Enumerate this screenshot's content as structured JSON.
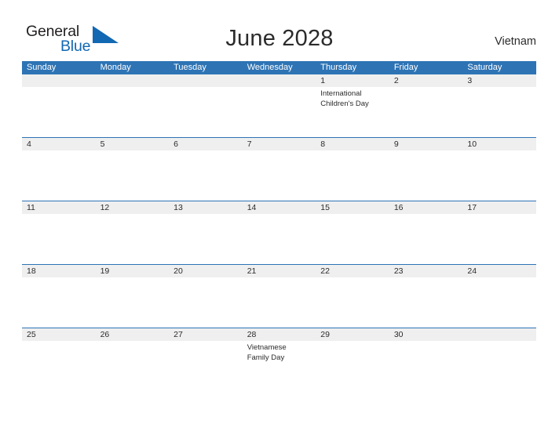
{
  "branding": {
    "logo_text_primary": "General",
    "logo_text_secondary": "Blue",
    "logo_flag_color": "#1268b3"
  },
  "header": {
    "title": "June 2028",
    "country": "Vietnam"
  },
  "colors": {
    "header_blue": "#2e74b5",
    "date_band_gray": "#efefef",
    "text_dark": "#2b2b2b",
    "logo_blue": "#1268b3",
    "page_background": "#ffffff"
  },
  "calendar": {
    "weekdays": [
      "Sunday",
      "Monday",
      "Tuesday",
      "Wednesday",
      "Thursday",
      "Friday",
      "Saturday"
    ],
    "weeks": [
      {
        "dates": [
          "",
          "",
          "",
          "",
          "1",
          "2",
          "3"
        ],
        "events": [
          "",
          "",
          "",
          "",
          "International Children's Day",
          "",
          ""
        ]
      },
      {
        "dates": [
          "4",
          "5",
          "6",
          "7",
          "8",
          "9",
          "10"
        ],
        "events": [
          "",
          "",
          "",
          "",
          "",
          "",
          ""
        ]
      },
      {
        "dates": [
          "11",
          "12",
          "13",
          "14",
          "15",
          "16",
          "17"
        ],
        "events": [
          "",
          "",
          "",
          "",
          "",
          "",
          ""
        ]
      },
      {
        "dates": [
          "18",
          "19",
          "20",
          "21",
          "22",
          "23",
          "24"
        ],
        "events": [
          "",
          "",
          "",
          "",
          "",
          "",
          ""
        ]
      },
      {
        "dates": [
          "25",
          "26",
          "27",
          "28",
          "29",
          "30",
          ""
        ],
        "events": [
          "",
          "",
          "",
          "Vietnamese Family Day",
          "",
          "",
          ""
        ]
      }
    ]
  }
}
